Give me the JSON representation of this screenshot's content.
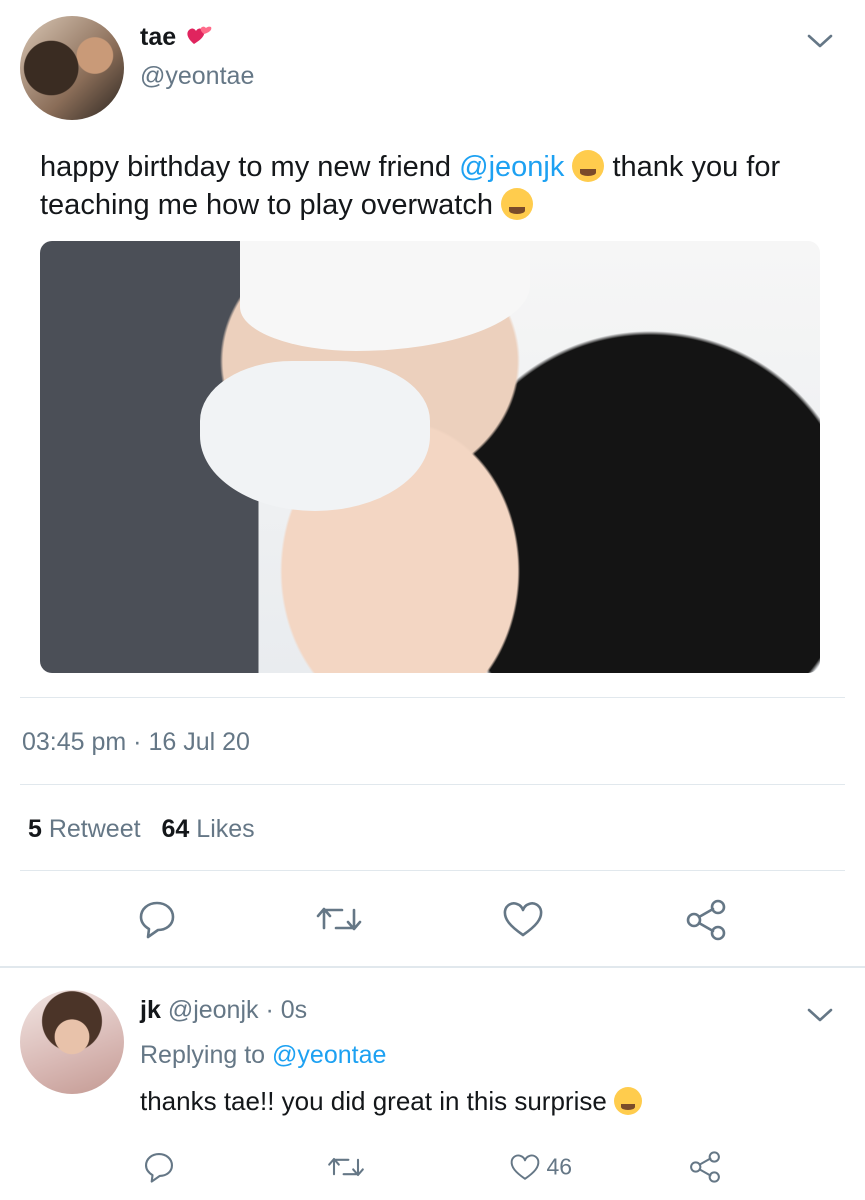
{
  "tweet": {
    "author_name": "tae",
    "author_handle": "@yeontae",
    "text_before": "happy birthday to my new friend ",
    "mention": "@jeonjk",
    "text_middle": " thank you for teaching me how to play overwatch ",
    "timestamp": "03:45 pm · 16 Jul 20",
    "retweet_count": "5",
    "retweet_label": " Retweet",
    "like_count": "64",
    "like_label": " Likes"
  },
  "reply": {
    "author_name": "jk",
    "author_handle": "@jeonjk",
    "time": "· 0s",
    "replying_label": "Replying to ",
    "replying_handle": "@yeontae",
    "text": "thanks tae!! you did great in this surprise ",
    "like_count": "46"
  },
  "icons": {
    "name_decoration": "hearts-emoji-icon",
    "mention_emoji": "yum-face-emoji-icon",
    "laugh_emoji": "tears-of-joy-emoji-icon"
  },
  "colors": {
    "link": "#1da1f2",
    "muted": "#657786",
    "heart": "#e0245e"
  }
}
